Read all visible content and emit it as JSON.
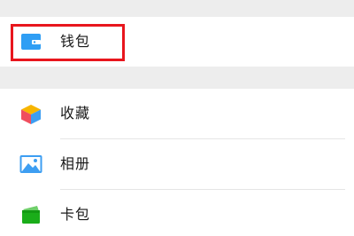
{
  "wallet_section": {
    "wallet": {
      "label": "钱包",
      "icon": "wallet-icon"
    }
  },
  "main_section": {
    "items": [
      {
        "label": "收藏",
        "icon": "favorites-cube-icon"
      },
      {
        "label": "相册",
        "icon": "photo-album-icon"
      },
      {
        "label": "卡包",
        "icon": "card-wallet-icon"
      }
    ]
  },
  "colors": {
    "background": "#ededed",
    "highlight": "#e8161d",
    "wallet_blue": "#2f9ef4",
    "album_blue": "#3d9ef2",
    "card_green": "#1aad19"
  }
}
